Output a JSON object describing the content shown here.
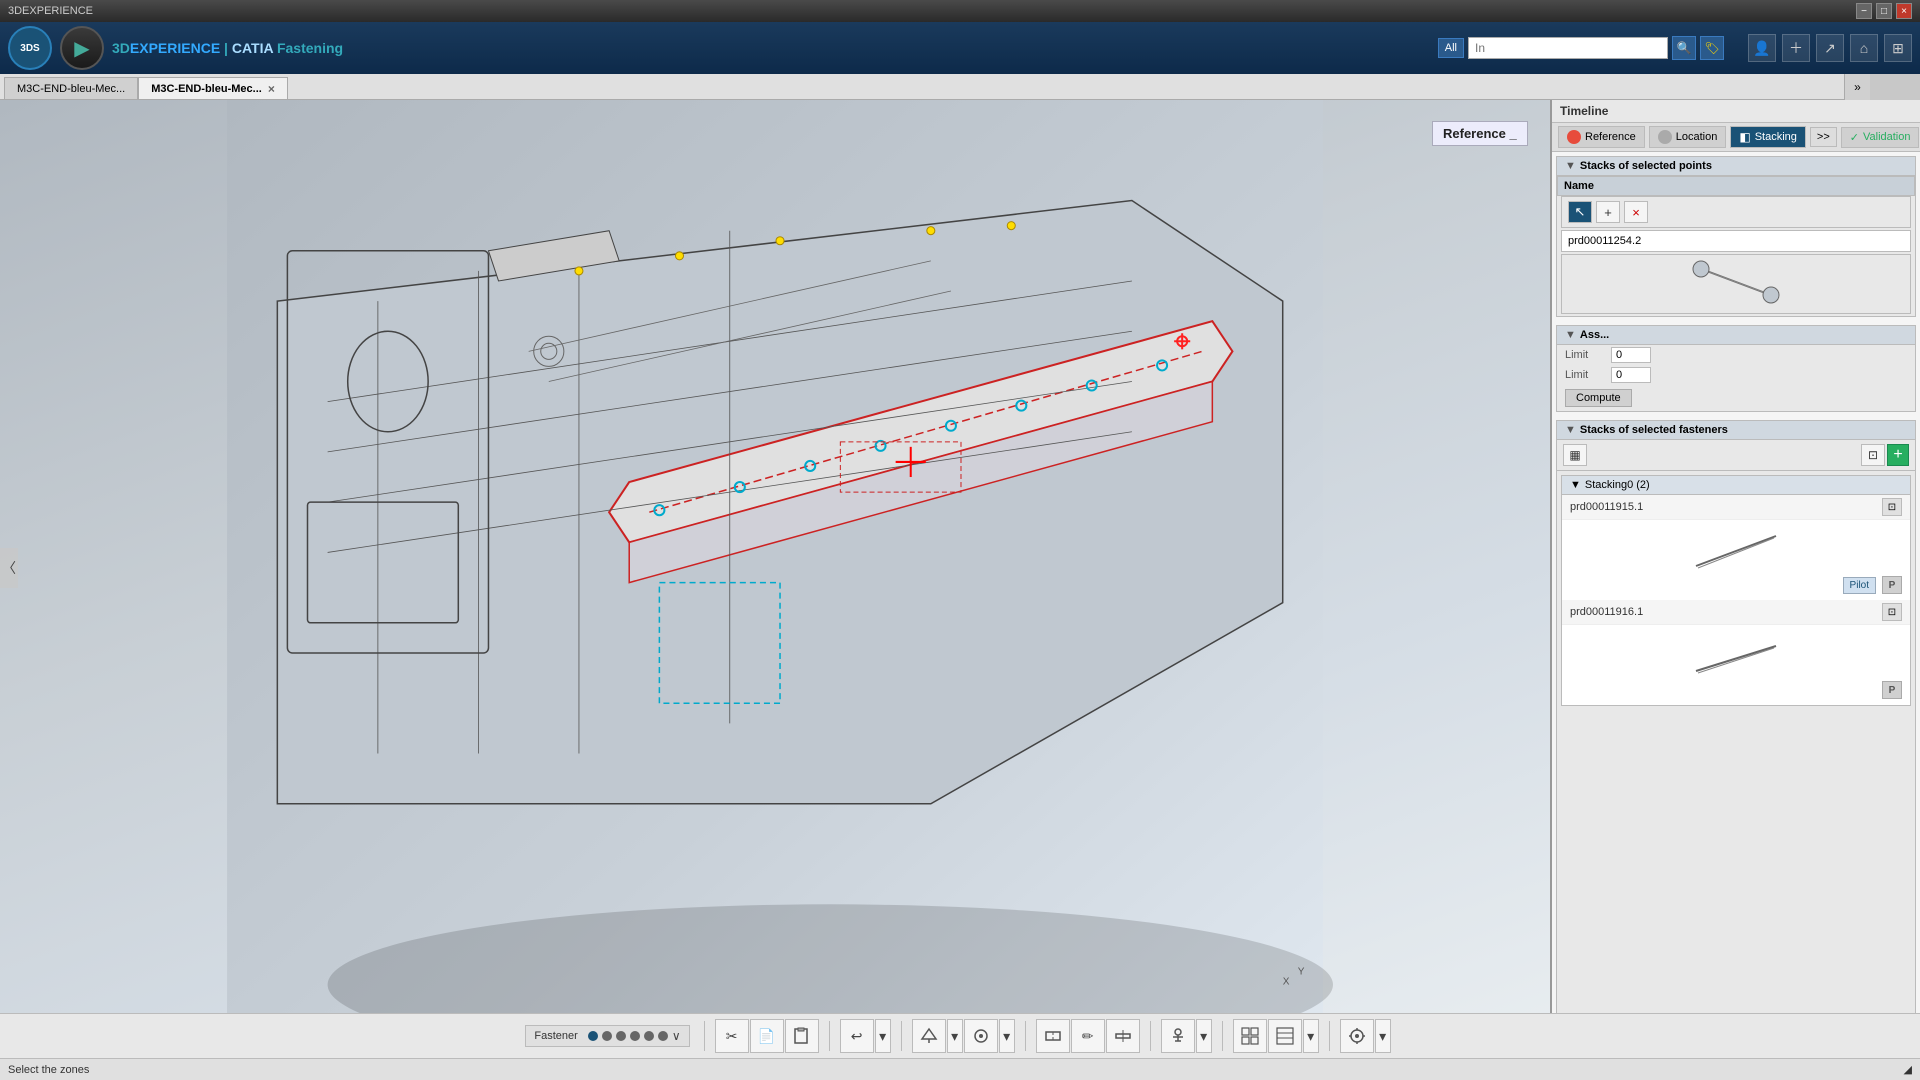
{
  "titlebar": {
    "title": "3DEXPERIENCE",
    "close_btn": "×",
    "min_btn": "−",
    "max_btn": "□"
  },
  "app": {
    "logo": "3DS",
    "title_prefix": "3D",
    "title_experience": "EXPERIENCE",
    "separator": " | ",
    "catia": "CATIA",
    "module": "Fastening",
    "play_icon": "▶"
  },
  "search": {
    "category": "All",
    "placeholder": "In",
    "search_icon": "🔍",
    "bookmark_icon": "🏷"
  },
  "tabs": [
    {
      "label": "M3C-END-bleu-Mec...",
      "active": false,
      "closable": false
    },
    {
      "label": "M3C-END-bleu-Mec...",
      "active": true,
      "closable": true
    }
  ],
  "timeline": {
    "header": "Timeline",
    "tabs": [
      {
        "id": "ref",
        "label": "Reference",
        "active": false
      },
      {
        "id": "loc",
        "label": "Location",
        "active": false
      },
      {
        "id": "stack",
        "label": "Stacking",
        "active": true
      }
    ],
    "arrow_btn": ">>",
    "validation_label": "Validation",
    "stacks_points_header": "Stacks of selected points",
    "name_col": "Name",
    "ref_entry": "prd00011254.2",
    "ass_header": "Ass...",
    "limit1_label": "Limit",
    "limit1_value": "0",
    "limit2_label": "Limit",
    "limit2_value": "0",
    "compute_label": "Compute",
    "stacks_fasteners_header": "Stacks of selected fasteners",
    "stacking_group": "Stacking0 (2)",
    "fastener1_id": "prd00011915.1",
    "fastener2_id": "prd00011916.1",
    "pilot_label": "Pilot",
    "p_badge": "P"
  },
  "bottom_toolbar": {
    "fastener_label": "Fastener",
    "dots_count": 6,
    "active_dot": 0,
    "icons": [
      "✂",
      "📄",
      "📋",
      "↩",
      "⬟",
      "⬡",
      "📐",
      "✏",
      "🔲",
      "⚙",
      "⚙",
      "⚙",
      "⬜",
      "▦",
      "▤",
      "⚙"
    ]
  },
  "status_bar": {
    "text": "Select the zones"
  },
  "viewport": {
    "description": "3D CAD model of car chassis/floor assembly"
  }
}
